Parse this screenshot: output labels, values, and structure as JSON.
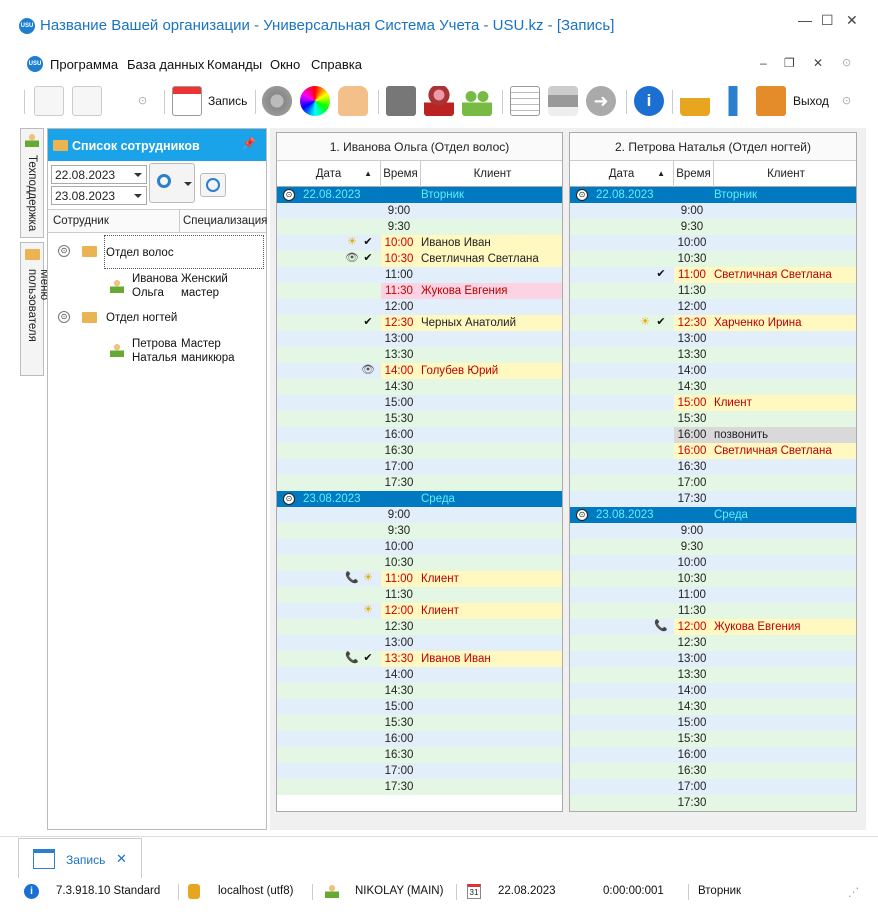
{
  "window": {
    "title": "Название Вашей организации - Универсальная Система Учета - USU.kz - [Запись]"
  },
  "menu": {
    "items": [
      "Программа",
      "База данных",
      "Команды",
      "Окно",
      "Справка"
    ]
  },
  "toolbar": {
    "record_label": "Запись",
    "exit_label": "Выход"
  },
  "side_tabs": {
    "support": "Техподдержка",
    "user_menu": "Меню пользователя"
  },
  "left_panel": {
    "title": "Список сотрудников",
    "date_from": "22.08.2023",
    "date_to": "23.08.2023",
    "col_employee": "Сотрудник",
    "col_spec": "Специализация",
    "groups": [
      {
        "name": "Отдел волос",
        "employees": [
          {
            "name_line1": "Иванова",
            "name_line2": "Ольга",
            "spec_line1": "Женский",
            "spec_line2": "мастер"
          }
        ]
      },
      {
        "name": "Отдел ногтей",
        "employees": [
          {
            "name_line1": "Петрова",
            "name_line2": "Наталья",
            "spec_line1": "Мастер",
            "spec_line2": "маникюра"
          }
        ]
      }
    ]
  },
  "schedule_headers": {
    "date": "Дата",
    "time": "Время",
    "client": "Клиент"
  },
  "schedules": [
    {
      "title": "1. Иванова Ольга (Отдел волос)",
      "rows": [
        {
          "kind": "group",
          "date": "22.08.2023",
          "weekday": "Вторник"
        },
        {
          "time": "9:00",
          "client": ""
        },
        {
          "time": "9:30",
          "client": ""
        },
        {
          "time": "10:00",
          "client": "Иванов Иван",
          "style": "yellow",
          "icons": [
            "sun",
            "check"
          ]
        },
        {
          "time": "10:30",
          "client": "Светличная Светлана",
          "style": "yellow",
          "icons": [
            "eye",
            "check"
          ]
        },
        {
          "time": "11:00",
          "client": ""
        },
        {
          "time": "11:30",
          "client": "Жукова Евгения",
          "style": "pink"
        },
        {
          "time": "12:00",
          "client": ""
        },
        {
          "time": "12:30",
          "client": "Черных Анатолий",
          "style": "yellow",
          "icons": [
            "check"
          ]
        },
        {
          "time": "13:00",
          "client": ""
        },
        {
          "time": "13:30",
          "client": ""
        },
        {
          "time": "14:00",
          "client": "Голубев Юрий",
          "style": "yellow-red",
          "icons": [
            "eye"
          ]
        },
        {
          "time": "14:30",
          "client": ""
        },
        {
          "time": "15:00",
          "client": ""
        },
        {
          "time": "15:30",
          "client": ""
        },
        {
          "time": "16:00",
          "client": ""
        },
        {
          "time": "16:30",
          "client": ""
        },
        {
          "time": "17:00",
          "client": ""
        },
        {
          "time": "17:30",
          "client": ""
        },
        {
          "kind": "group",
          "date": "23.08.2023",
          "weekday": "Среда"
        },
        {
          "time": "9:00",
          "client": ""
        },
        {
          "time": "9:30",
          "client": ""
        },
        {
          "time": "10:00",
          "client": ""
        },
        {
          "time": "10:30",
          "client": ""
        },
        {
          "time": "11:00",
          "client": "Клиент",
          "style": "yellow-red",
          "icons": [
            "phone",
            "sun"
          ]
        },
        {
          "time": "11:30",
          "client": ""
        },
        {
          "time": "12:00",
          "client": "Клиент",
          "style": "yellow-red",
          "icons": [
            "sun"
          ]
        },
        {
          "time": "12:30",
          "client": ""
        },
        {
          "time": "13:00",
          "client": ""
        },
        {
          "time": "13:30",
          "client": "Иванов Иван",
          "style": "yellow-red",
          "icons": [
            "phone",
            "check"
          ]
        },
        {
          "time": "14:00",
          "client": ""
        },
        {
          "time": "14:30",
          "client": ""
        },
        {
          "time": "15:00",
          "client": ""
        },
        {
          "time": "15:30",
          "client": ""
        },
        {
          "time": "16:00",
          "client": ""
        },
        {
          "time": "16:30",
          "client": ""
        },
        {
          "time": "17:00",
          "client": ""
        },
        {
          "time": "17:30",
          "client": ""
        }
      ]
    },
    {
      "title": "2. Петрова Наталья (Отдел ногтей)",
      "rows": [
        {
          "kind": "group",
          "date": "22.08.2023",
          "weekday": "Вторник"
        },
        {
          "time": "9:00",
          "client": ""
        },
        {
          "time": "9:30",
          "client": ""
        },
        {
          "time": "10:00",
          "client": ""
        },
        {
          "time": "10:30",
          "client": ""
        },
        {
          "time": "11:00",
          "client": "Светличная Светлана",
          "style": "yellow-red",
          "icons": [
            "check"
          ]
        },
        {
          "time": "11:30",
          "client": ""
        },
        {
          "time": "12:00",
          "client": ""
        },
        {
          "time": "12:30",
          "client": "Харченко Ирина",
          "style": "yellow-red",
          "icons": [
            "sun",
            "check"
          ]
        },
        {
          "time": "13:00",
          "client": ""
        },
        {
          "time": "13:30",
          "client": ""
        },
        {
          "time": "14:00",
          "client": ""
        },
        {
          "time": "14:30",
          "client": ""
        },
        {
          "time": "15:00",
          "client": "Клиент",
          "style": "yellow-red"
        },
        {
          "time": "15:30",
          "client": ""
        },
        {
          "time": "16:00",
          "client": "позвонить",
          "style": "gray"
        },
        {
          "time": "16:00",
          "client": "Светличная Светлана",
          "style": "yellow-red"
        },
        {
          "time": "16:30",
          "client": ""
        },
        {
          "time": "17:00",
          "client": ""
        },
        {
          "time": "17:30",
          "client": ""
        },
        {
          "kind": "group",
          "date": "23.08.2023",
          "weekday": "Среда"
        },
        {
          "time": "9:00",
          "client": ""
        },
        {
          "time": "9:30",
          "client": ""
        },
        {
          "time": "10:00",
          "client": ""
        },
        {
          "time": "10:30",
          "client": ""
        },
        {
          "time": "11:00",
          "client": ""
        },
        {
          "time": "11:30",
          "client": ""
        },
        {
          "time": "12:00",
          "client": "Жукова Евгения",
          "style": "yellow-red",
          "icons": [
            "phone"
          ]
        },
        {
          "time": "12:30",
          "client": ""
        },
        {
          "time": "13:00",
          "client": ""
        },
        {
          "time": "13:30",
          "client": ""
        },
        {
          "time": "14:00",
          "client": ""
        },
        {
          "time": "14:30",
          "client": ""
        },
        {
          "time": "15:00",
          "client": ""
        },
        {
          "time": "15:30",
          "client": ""
        },
        {
          "time": "16:00",
          "client": ""
        },
        {
          "time": "16:30",
          "client": ""
        },
        {
          "time": "17:00",
          "client": ""
        },
        {
          "time": "17:30",
          "client": ""
        }
      ]
    }
  ],
  "bottom_tab": {
    "label": "Запись"
  },
  "status": {
    "version": "7.3.918.10 Standard",
    "db": "localhost (utf8)",
    "user": "NIKOLAY (MAIN)",
    "calendar_day": "31",
    "date": "22.08.2023",
    "elapsed": "0:00:00:001",
    "weekday": "Вторник"
  },
  "colors": {
    "accent": "#1aa3e8",
    "group_row": "#0079c1",
    "row_green": "#e4f6e4",
    "row_blue": "#e2eefa",
    "booked": "#fff8c0",
    "pink": "#fbd3e3"
  }
}
